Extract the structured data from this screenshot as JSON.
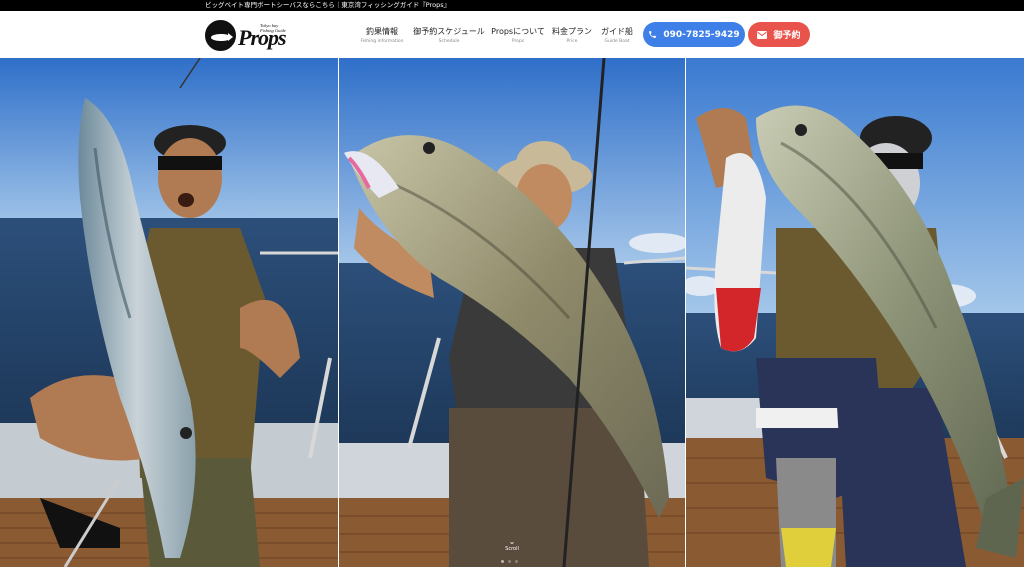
{
  "topbar": {
    "text": "ビッグベイト専門ボートシーバスならこちら｜東京湾フィッシングガイド『Props』"
  },
  "logo": {
    "tagline1": "Tokyo bay",
    "tagline2": "Fishing Guide",
    "wordmark": "Props"
  },
  "nav": [
    {
      "label": "釣果情報",
      "sub": "Fishing information"
    },
    {
      "label": "御予約スケジュール",
      "sub": "Schedule"
    },
    {
      "label": "Propsについて",
      "sub": "Props"
    },
    {
      "label": "料金プラン",
      "sub": "Price"
    },
    {
      "label": "ガイド船",
      "sub": "Guide Boat"
    }
  ],
  "buttons": {
    "phone": "090-7825-9429",
    "reserve": "御予約"
  },
  "hero": {
    "scroll_label": "Scroll"
  },
  "colors": {
    "phone_button": "#3f7fe8",
    "reserve_button": "#e8534b",
    "topbar": "#000000"
  },
  "icons": {
    "phone": "phone-icon",
    "mail": "mail-icon",
    "scroll": "chevron-down-icon"
  }
}
